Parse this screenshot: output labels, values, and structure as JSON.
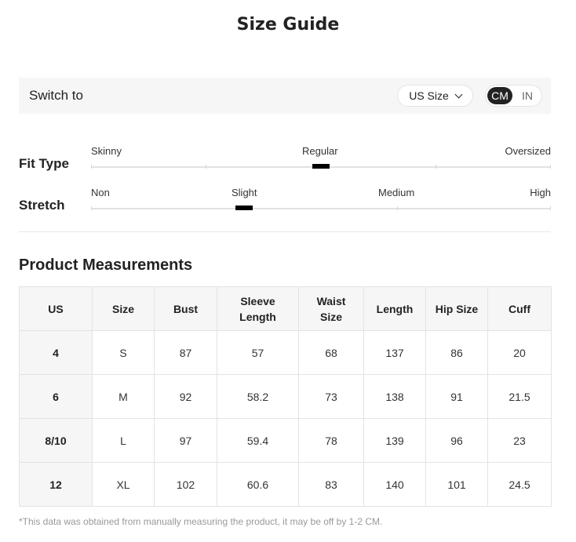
{
  "title": "Size Guide",
  "switch": {
    "label": "Switch to",
    "size_system": "US Size",
    "units": [
      {
        "label": "CM",
        "selected": true
      },
      {
        "label": "IN",
        "selected": false
      }
    ]
  },
  "fit_type": {
    "title": "Fit Type",
    "labels": [
      "Skinny",
      "Regular",
      "Oversized"
    ],
    "selected": "Regular",
    "selected_fraction": 0.5
  },
  "stretch": {
    "title": "Stretch",
    "labels": [
      "Non",
      "Slight",
      "Medium",
      "High"
    ],
    "selected": "Slight",
    "selected_fraction": 0.333
  },
  "measurements": {
    "title": "Product Measurements",
    "headers": [
      [
        "US"
      ],
      [
        "Size"
      ],
      [
        "Bust"
      ],
      [
        "Sleeve",
        "Length"
      ],
      [
        "Waist",
        "Size"
      ],
      [
        "Length"
      ],
      [
        "Hip Size"
      ],
      [
        "Cuff"
      ]
    ],
    "rows": [
      [
        "4",
        "S",
        "87",
        "57",
        "68",
        "137",
        "86",
        "20"
      ],
      [
        "6",
        "M",
        "92",
        "58.2",
        "73",
        "138",
        "91",
        "21.5"
      ],
      [
        "8/10",
        "L",
        "97",
        "59.4",
        "78",
        "139",
        "96",
        "23"
      ],
      [
        "12",
        "XL",
        "102",
        "60.6",
        "83",
        "140",
        "101",
        "24.5"
      ]
    ]
  },
  "note": "*This data was obtained from manually measuring the product, it may be off by 1-2 CM."
}
